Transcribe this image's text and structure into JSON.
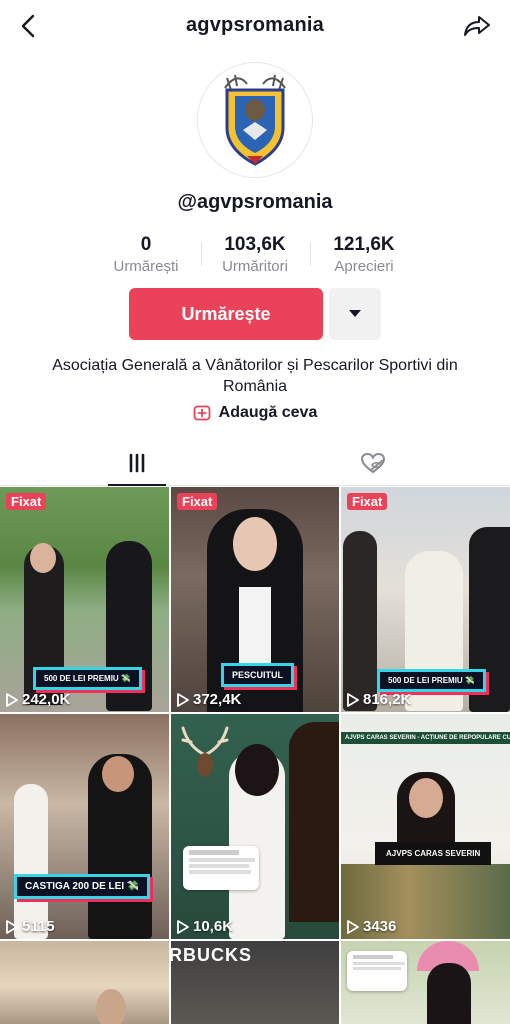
{
  "header": {
    "username": "agvpsromania",
    "back_icon": "chevron-left-icon",
    "share_icon": "share-arrow-icon"
  },
  "profile": {
    "handle": "@agvpsromania",
    "avatar": "agvps-crest-logo"
  },
  "stats": [
    {
      "value": "0",
      "label": "Urmărești"
    },
    {
      "value": "103,6K",
      "label": "Urmăritori"
    },
    {
      "value": "121,6K",
      "label": "Aprecieri"
    }
  ],
  "actions": {
    "follow_label": "Urmărește",
    "more_icon": "caret-down-icon"
  },
  "bio": {
    "text": "Asociația Generală a Vânătorilor și Pescarilor Sportivi din România",
    "add_label": "Adaugă ceva",
    "add_icon": "add-square-icon"
  },
  "tabs": {
    "videos_icon": "grid-bars-icon",
    "liked_icon": "hidden-heart-icon"
  },
  "videos": [
    {
      "pinned": "Fixat",
      "caption": "500 DE LEI PREMIU 💸",
      "views": "242,0K"
    },
    {
      "pinned": "Fixat",
      "caption": "PESCUITUL",
      "views": "372,4K"
    },
    {
      "pinned": "Fixat",
      "caption": "500 DE LEI PREMIU 💸",
      "views": "816,2K"
    },
    {
      "caption": "CASTIGA 200 DE LEI 💸",
      "views": "5115"
    },
    {
      "views": "10,6K"
    },
    {
      "banner": "AJVPS CARAS SEVERIN - ACȚIUNE DE REPOPULARE CU PĂSTRĂV",
      "caption": "AJVPS CARAS SEVERIN",
      "views": "3436"
    },
    {},
    {
      "overlay": "RBUCKS"
    },
    {}
  ],
  "colors": {
    "accent": "#ea4359",
    "caption_border": "#35d4e6",
    "caption_shadow": "#f0305a"
  }
}
